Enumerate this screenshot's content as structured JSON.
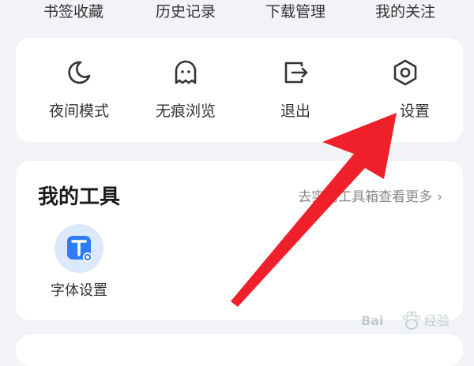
{
  "top_row": {
    "items": [
      {
        "label": "书签收藏"
      },
      {
        "label": "历史记录"
      },
      {
        "label": "下载管理"
      },
      {
        "label": "我的关注"
      }
    ]
  },
  "menu": {
    "items": [
      {
        "label": "夜间模式",
        "icon": "moon-icon"
      },
      {
        "label": "无痕浏览",
        "icon": "ghost-icon"
      },
      {
        "label": "退出",
        "icon": "exit-icon"
      },
      {
        "label": "设置",
        "icon": "settings-icon"
      }
    ]
  },
  "tools": {
    "title": "我的工具",
    "more_link": "去实用工具箱查看更多",
    "items": [
      {
        "label": "字体设置",
        "icon": "font-settings-icon"
      }
    ]
  },
  "watermark": {
    "text_a": "Bai",
    "text_b": "经验"
  },
  "colors": {
    "background": "#f2f3f7",
    "card": "#ffffff",
    "arrow": "#f0202a",
    "tool_icon_bg": "#dce8fb",
    "tool_icon_accent": "#2e7cf6"
  }
}
